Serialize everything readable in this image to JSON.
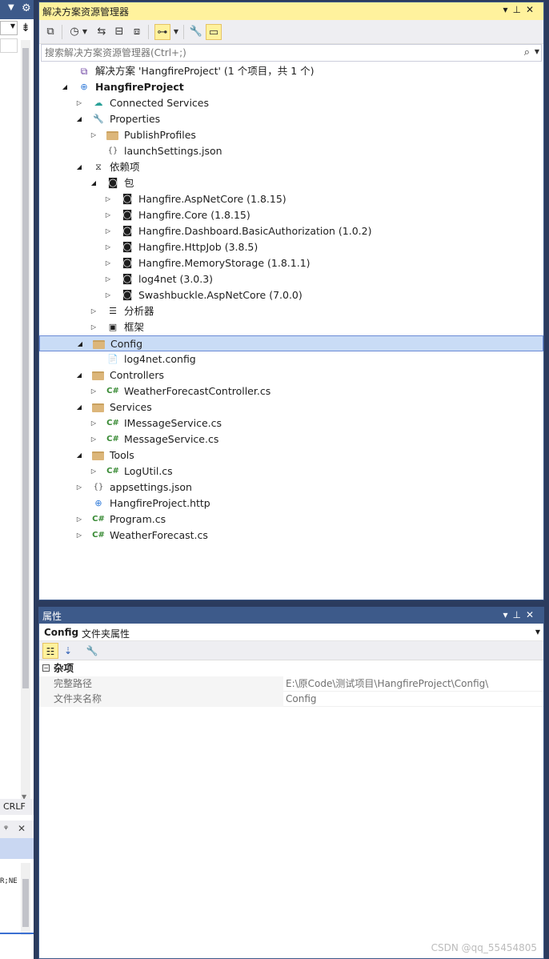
{
  "left": {
    "line_ending": "CRLF",
    "code_fragment": "R;NE"
  },
  "solution_explorer": {
    "title": "解决方案资源管理器",
    "search_placeholder": "搜索解决方案资源管理器(Ctrl+;)",
    "tree": [
      {
        "label": "解决方案 'HangfireProject' (1 个项目，共 1 个)",
        "icon": "solution-icon",
        "depth": 0,
        "arrow": "",
        "bold": false
      },
      {
        "label": "HangfireProject",
        "icon": "globe-project-icon",
        "depth": 0,
        "arrow": "expanded",
        "bold": true
      },
      {
        "label": "Connected Services",
        "icon": "cloud-icon",
        "depth": 1,
        "arrow": "collapsed",
        "bold": false
      },
      {
        "label": "Properties",
        "icon": "wrench-icon",
        "depth": 1,
        "arrow": "expanded",
        "bold": false
      },
      {
        "label": "PublishProfiles",
        "icon": "folder-icon",
        "depth": 2,
        "arrow": "collapsed",
        "bold": false
      },
      {
        "label": "launchSettings.json",
        "icon": "json-icon",
        "depth": 2,
        "arrow": "",
        "bold": false
      },
      {
        "label": "依赖项",
        "icon": "dependencies-icon",
        "depth": 1,
        "arrow": "expanded",
        "bold": false
      },
      {
        "label": "包",
        "icon": "package-icon",
        "depth": 2,
        "arrow": "expanded",
        "bold": false
      },
      {
        "label": "Hangfire.AspNetCore (1.8.15)",
        "icon": "package-icon",
        "depth": 3,
        "arrow": "collapsed",
        "bold": false
      },
      {
        "label": "Hangfire.Core (1.8.15)",
        "icon": "package-icon",
        "depth": 3,
        "arrow": "collapsed",
        "bold": false
      },
      {
        "label": "Hangfire.Dashboard.BasicAuthorization (1.0.2)",
        "icon": "package-icon",
        "depth": 3,
        "arrow": "collapsed",
        "bold": false
      },
      {
        "label": "Hangfire.HttpJob (3.8.5)",
        "icon": "package-icon",
        "depth": 3,
        "arrow": "collapsed",
        "bold": false
      },
      {
        "label": "Hangfire.MemoryStorage (1.8.1.1)",
        "icon": "package-icon",
        "depth": 3,
        "arrow": "collapsed",
        "bold": false
      },
      {
        "label": "log4net (3.0.3)",
        "icon": "package-icon",
        "depth": 3,
        "arrow": "collapsed",
        "bold": false
      },
      {
        "label": "Swashbuckle.AspNetCore (7.0.0)",
        "icon": "package-icon",
        "depth": 3,
        "arrow": "collapsed",
        "bold": false
      },
      {
        "label": "分析器",
        "icon": "analyzer-icon",
        "depth": 2,
        "arrow": "collapsed",
        "bold": false
      },
      {
        "label": "框架",
        "icon": "framework-icon",
        "depth": 2,
        "arrow": "collapsed",
        "bold": false
      },
      {
        "label": "Config",
        "icon": "folder-icon",
        "depth": 1,
        "arrow": "expanded",
        "bold": false,
        "selected": true
      },
      {
        "label": "log4net.config",
        "icon": "config-file-icon",
        "depth": 2,
        "arrow": "",
        "bold": false
      },
      {
        "label": "Controllers",
        "icon": "folder-icon",
        "depth": 1,
        "arrow": "expanded",
        "bold": false
      },
      {
        "label": "WeatherForecastController.cs",
        "icon": "csharp-icon",
        "depth": 2,
        "arrow": "collapsed",
        "bold": false
      },
      {
        "label": "Services",
        "icon": "folder-icon",
        "depth": 1,
        "arrow": "expanded",
        "bold": false
      },
      {
        "label": "IMessageService.cs",
        "icon": "csharp-icon",
        "depth": 2,
        "arrow": "collapsed",
        "bold": false
      },
      {
        "label": "MessageService.cs",
        "icon": "csharp-icon",
        "depth": 2,
        "arrow": "collapsed",
        "bold": false
      },
      {
        "label": "Tools",
        "icon": "folder-icon",
        "depth": 1,
        "arrow": "expanded",
        "bold": false
      },
      {
        "label": "LogUtil.cs",
        "icon": "csharp-icon",
        "depth": 2,
        "arrow": "collapsed",
        "bold": false
      },
      {
        "label": "appsettings.json",
        "icon": "json-icon",
        "depth": 1,
        "arrow": "collapsed",
        "bold": false
      },
      {
        "label": "HangfireProject.http",
        "icon": "globe-file-icon",
        "depth": 1,
        "arrow": "",
        "bold": false
      },
      {
        "label": "Program.cs",
        "icon": "csharp-icon",
        "depth": 1,
        "arrow": "collapsed",
        "bold": false
      },
      {
        "label": "WeatherForecast.cs",
        "icon": "csharp-icon",
        "depth": 1,
        "arrow": "collapsed",
        "bold": false
      }
    ]
  },
  "properties": {
    "title": "属性",
    "object_name": "Config",
    "object_type": "文件夹属性",
    "category": "杂项",
    "rows": [
      {
        "key": "完整路径",
        "value": "E:\\原Code\\测试项目\\HangfireProject\\Config\\"
      },
      {
        "key": "文件夹名称",
        "value": "Config"
      }
    ]
  },
  "watermark": "CSDN @qq_55454805",
  "colors": {
    "accent_yellow": "#fff29d",
    "frame_blue": "#3d5a8a",
    "selection": "#c9dcf6",
    "csharp_green": "#388a34",
    "folder": "#dcb67a"
  }
}
